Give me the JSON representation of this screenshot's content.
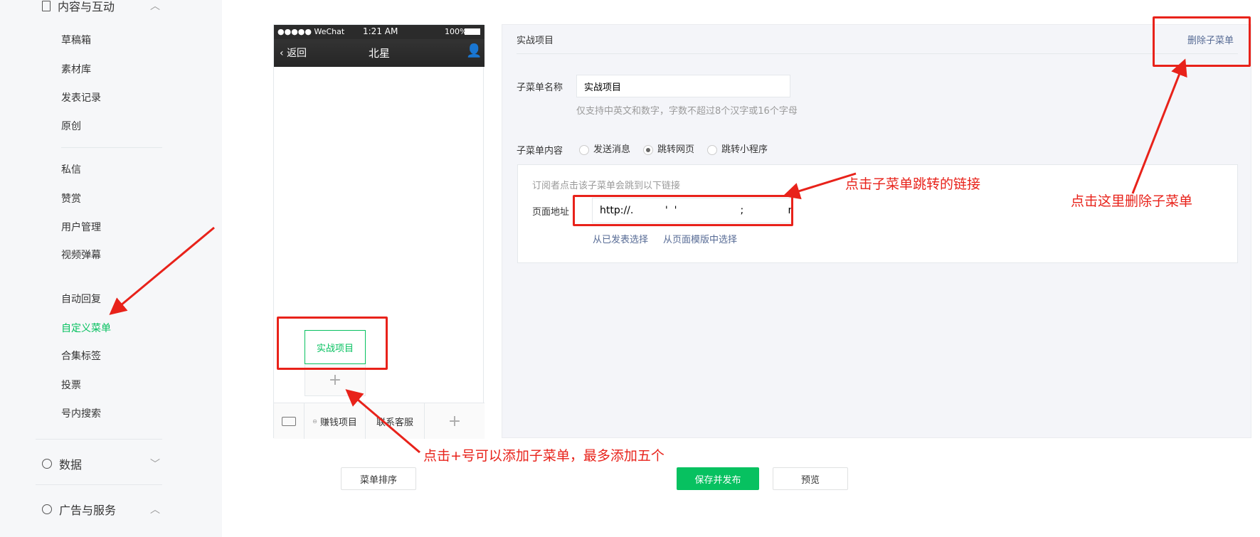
{
  "sidebar": {
    "section_content": "内容与互动",
    "items": [
      "草稿箱",
      "素材库",
      "发表记录",
      "原创",
      "私信",
      "赞赏",
      "用户管理",
      "视频弹幕",
      "自动回复",
      "自定义菜单",
      "合集标签",
      "投票",
      "号内搜索"
    ],
    "active": "自定义菜单",
    "section_data": "数据",
    "section_ads": "广告与服务"
  },
  "phone": {
    "carrier": "●●●●● WeChat",
    "time": "1:21 AM",
    "battery": "100%",
    "back": "返回",
    "title": "北星",
    "submenu_item": "实战项目",
    "add_submenu": "+",
    "menu": [
      "赚钱项目",
      "联系客服"
    ],
    "add_menu": "+"
  },
  "editor": {
    "header_title": "实战项目",
    "delete_link": "删除子菜单",
    "name_label": "子菜单名称",
    "name_value": "实战项目",
    "name_hint": "仅支持中英文和数字，字数不超过8个汉字或16个字母",
    "content_label": "子菜单内容",
    "options": [
      "发送消息",
      "跳转网页",
      "跳转小程序"
    ],
    "selected_option": "跳转网页",
    "link_desc": "订阅者点击该子菜单会跳到以下链接",
    "url_label": "页面地址",
    "url_value": "http://.          '  '                    ;              nepag",
    "pick_published": "从已发表选择",
    "pick_template": "从页面模版中选择"
  },
  "buttons": {
    "sort": "菜单排序",
    "save": "保存并发布",
    "preview": "预览"
  },
  "annotations": {
    "link_note": "点击子菜单跳转的链接",
    "delete_note": "点击这里删除子菜单",
    "add_note": "点击+号可以添加子菜单，最多添加五个"
  },
  "colors": {
    "accent": "#07c160",
    "annotation": "#e8221a",
    "link": "#576b95"
  }
}
